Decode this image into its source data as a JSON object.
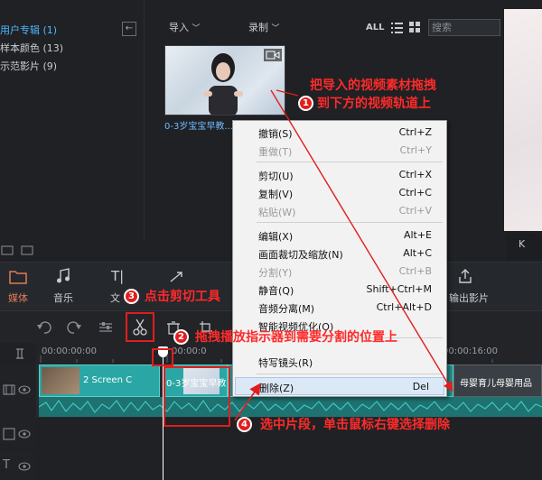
{
  "library": {
    "items": [
      {
        "label": "用户专辑 (1)",
        "active": true
      },
      {
        "label": "样本颜色 (13)",
        "active": false
      },
      {
        "label": "示范影片 (9)",
        "active": false
      }
    ],
    "collapse": "←"
  },
  "media_bar": {
    "import_label": "导入",
    "record_label": "录制",
    "all_label": "ALL",
    "search_placeholder": "搜索"
  },
  "media": {
    "caption": "0-3岁宝宝早教..."
  },
  "tools": {
    "media_label": "媒体",
    "music_label": "音乐",
    "text_label": "文",
    "export_label": "输出影片"
  },
  "ruler": {
    "start": "00:00:00:00",
    "mid": "00:00:0",
    "end": "00:00:16:00"
  },
  "clips": {
    "clip1": "2 Screen C",
    "clip2": "0-3岁宝宝早教",
    "clip3": "母婴育儿母婴用品"
  },
  "context_menu": {
    "items": [
      {
        "label": "撤销(S)",
        "shortcut": "Ctrl+Z",
        "disabled": false
      },
      {
        "label": "重做(T)",
        "shortcut": "Ctrl+Y",
        "disabled": true
      },
      {
        "label": "剪切(U)",
        "shortcut": "Ctrl+X",
        "disabled": false
      },
      {
        "label": "复制(V)",
        "shortcut": "Ctrl+C",
        "disabled": false
      },
      {
        "label": "粘贴(W)",
        "shortcut": "Ctrl+V",
        "disabled": true
      },
      {
        "label": "编辑(X)",
        "shortcut": "Alt+E",
        "disabled": false
      },
      {
        "label": "画面裁切及缩放(N)",
        "shortcut": "Alt+C",
        "disabled": false
      },
      {
        "label": "分割(Y)",
        "shortcut": "Ctrl+B",
        "disabled": true
      },
      {
        "label": "静音(Q)",
        "shortcut": "Shift+Ctrl+M",
        "disabled": false
      },
      {
        "label": "音频分离(M)",
        "shortcut": "Ctrl+Alt+D",
        "disabled": false
      },
      {
        "label": "智能视频优化(O)",
        "shortcut": "",
        "disabled": false
      },
      {
        "label": "特写镜头(R)",
        "shortcut": "",
        "disabled": false
      },
      {
        "label": "删除(Z)",
        "shortcut": "Del",
        "disabled": false
      }
    ]
  },
  "annotations": {
    "step1_num": "1",
    "step1_line1": "把导入的视频素材拖拽",
    "step1_line2": "到下方的视频轨道上",
    "step2_num": "2",
    "step2_text": "拖拽播放指示器到需要分割的位置上",
    "step3_num": "3",
    "step3_text": "点击剪切工具",
    "step4_num": "4",
    "step4_text": "选中片段，单击鼠标右键选择删除"
  },
  "colors": {
    "accent_blue": "#4fb8ff",
    "clip_teal": "#2aa7a5",
    "annotation_red": "#ff2a2a",
    "tool_orange": "#e07a5a"
  }
}
